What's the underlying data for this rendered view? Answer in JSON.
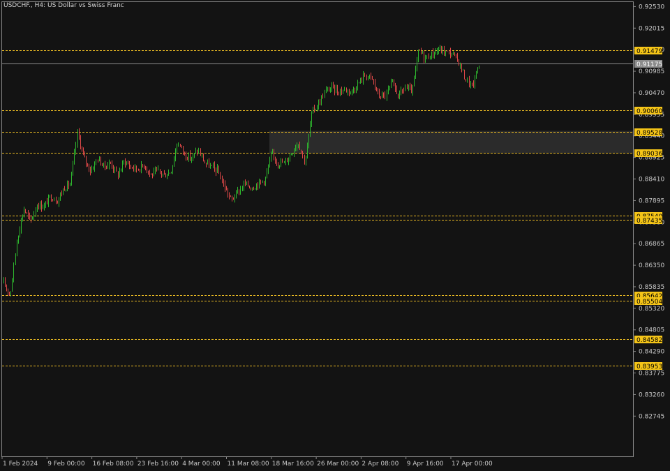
{
  "chart_title": "USDCHF., H4:  US Dollar vs Swiss Franc",
  "colors": {
    "background": "#131313",
    "axis": "#8a8a8a",
    "bull_candle": "#2eb82e",
    "bear_candle": "#e04848",
    "level_line": "#e8b923",
    "level_label_bg": "#f5c518",
    "current_price_line": "#8c8c8c",
    "current_price_label_bg": "#8c8c8c",
    "zone_fill": "#2b2b2b"
  },
  "chart_data": {
    "type": "candlestick",
    "title": "USDCHF., H4:  US Dollar vs Swiss Franc",
    "ylim": [
      0.8225,
      0.9262
    ],
    "y_ticks": [
      "0.92530",
      "0.92015",
      "0.91500",
      "0.90985",
      "0.90470",
      "0.89955",
      "0.89440",
      "0.88925",
      "0.88410",
      "0.87895",
      "0.87380",
      "0.86865",
      "0.86350",
      "0.85835",
      "0.85320",
      "0.84805",
      "0.84290",
      "0.83775",
      "0.83260",
      "0.82745"
    ],
    "x_ticks": [
      "1 Feb 2024",
      "9 Feb 00:00",
      "16 Feb 08:00",
      "23 Feb 16:00",
      "4 Mar 00:00",
      "11 Mar 08:00",
      "18 Mar 16:00",
      "26 Mar 00:00",
      "2 Apr 08:00",
      "9 Apr 16:00",
      "17 Apr 00:00"
    ],
    "levels": [
      "0.91479",
      "0.90060",
      "0.89528",
      "0.89036",
      "0.87540",
      "0.87435",
      "0.85642",
      "0.85504",
      "0.84582",
      "0.83953"
    ],
    "current_price": "0.91175",
    "supply_demand_zone": [
      0.8902,
      0.8956
    ],
    "price_path": [
      0.8592,
      0.8565,
      0.87,
      0.877,
      0.874,
      0.878,
      0.8775,
      0.88,
      0.879,
      0.882,
      0.883,
      0.895,
      0.889,
      0.886,
      0.889,
      0.887,
      0.888,
      0.885,
      0.8885,
      0.887,
      0.8865,
      0.8875,
      0.885,
      0.886,
      0.885,
      0.886,
      0.893,
      0.89,
      0.889,
      0.891,
      0.888,
      0.887,
      0.886,
      0.882,
      0.879,
      0.881,
      0.883,
      0.882,
      0.883,
      0.884,
      0.89,
      0.888,
      0.888,
      0.8905,
      0.893,
      0.888,
      0.9,
      0.902,
      0.905,
      0.906,
      0.905,
      0.9055,
      0.905,
      0.907,
      0.909,
      0.908,
      0.904,
      0.904,
      0.907,
      0.904,
      0.906,
      0.905,
      0.915,
      0.913,
      0.914,
      0.915,
      0.9145,
      0.914,
      0.912,
      0.908,
      0.906,
      0.9118
    ],
    "candle_count": 330
  }
}
